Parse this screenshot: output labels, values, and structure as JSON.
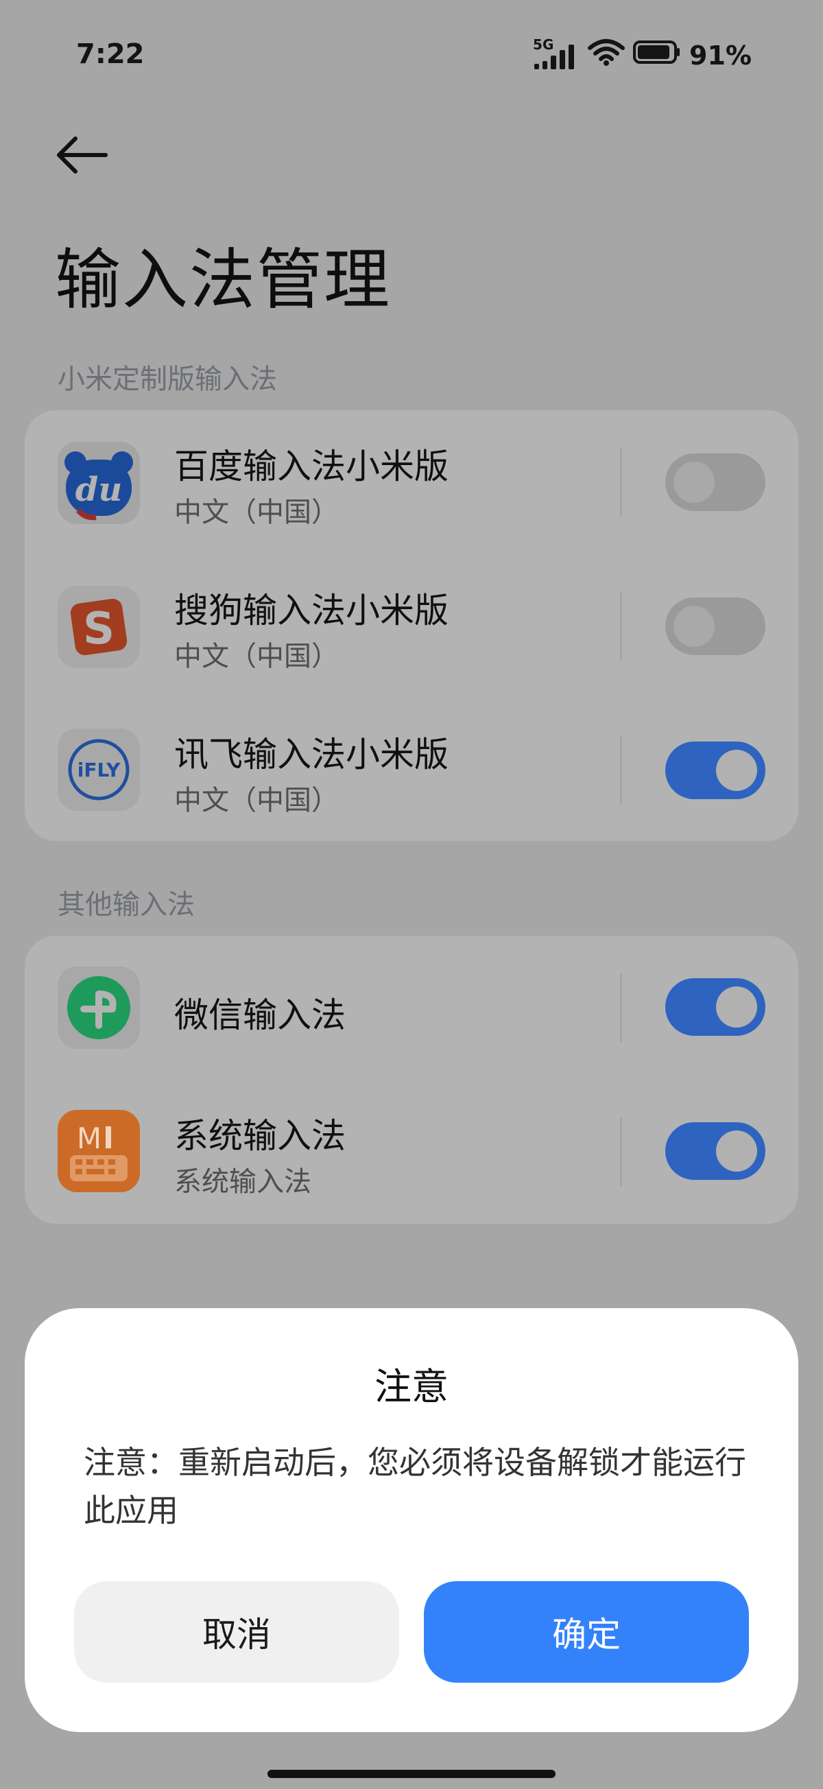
{
  "status_bar": {
    "time": "7:22",
    "network": "5G",
    "battery": "91%",
    "battery_level": 0.91,
    "icons": [
      "signal-icon",
      "wifi-icon",
      "battery-icon"
    ]
  },
  "header": {
    "back_icon": "arrow-left-icon",
    "title": "输入法管理"
  },
  "sections": {
    "xiaomi_label": "小米定制版输入法",
    "other_label": "其他输入法"
  },
  "xiaomi_apps": [
    {
      "name": "百度输入法小米版",
      "sub": "中文（中国）",
      "icon": "baidu-du-icon",
      "enabled": false
    },
    {
      "name": "搜狗输入法小米版",
      "sub": "中文（中国）",
      "icon": "sogou-s-icon",
      "enabled": false
    },
    {
      "name": "讯飞输入法小米版",
      "sub": "中文（中国）",
      "icon": "ifly-icon",
      "icon_text": "iFLY",
      "enabled": true
    }
  ],
  "other_apps": [
    {
      "name": "微信输入法",
      "sub": "",
      "icon": "wechat-input-icon",
      "enabled": true
    },
    {
      "name": "系统输入法",
      "sub": "系统输入法",
      "icon": "system-keyboard-icon",
      "icon_text": "M",
      "enabled": true
    }
  ],
  "dialog": {
    "title": "注意",
    "message": "注意：重新启动后，您必须将设备解锁才能运行此应用",
    "cancel_label": "取消",
    "confirm_label": "确定"
  },
  "colors": {
    "accent": "#3482fa",
    "toggle_on": "#2e63c0",
    "scrim": "#a6a6a6"
  }
}
